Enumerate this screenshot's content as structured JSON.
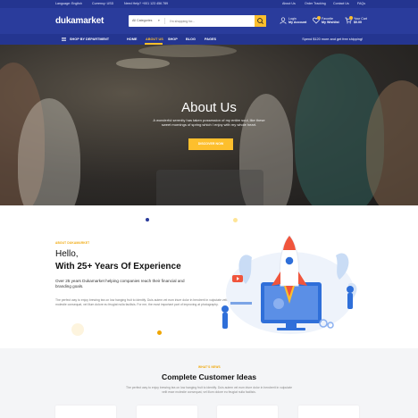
{
  "topbar": {
    "language": "Language: English",
    "currency": "Currency: USD",
    "help": "Need Help? +001 123 456 789",
    "links": [
      "About Us",
      "Order Tracking",
      "Contact Us",
      "FAQs"
    ]
  },
  "header": {
    "logo": "dukamarket",
    "search": {
      "category": "All Categories",
      "placeholder": "I'm shopping for..."
    },
    "account": {
      "line1": "Login",
      "line2": "My Account"
    },
    "wishlist": {
      "line1": "Favorite",
      "line2": "My Wishlist",
      "count": "0"
    },
    "cart": {
      "line1": "Your Cart",
      "line2": "$0.00",
      "count": "0"
    }
  },
  "nav": {
    "department": "SHOP BY DEPARTMENT",
    "items": [
      "HOME",
      "ABOUT US",
      "SHOP",
      "BLOG",
      "PAGES"
    ],
    "active_index": 1,
    "promo": "Spend $120 more and get free shipping!"
  },
  "hero": {
    "title": "About Us",
    "subtitle": "A wonderful serenity has taken possession of my entire soul, like these sweet mornings of spring which I enjoy with my whole heart.",
    "cta": "DISCOVER NOW"
  },
  "about": {
    "kicker": "ABOUT DUKAMARKET",
    "heading_line1": "Hello,",
    "heading_line2": "With 25+ Years Of Experience",
    "paragraph1": "Over 25 years Dukamarket helping companies reach their financial and branding goals.",
    "paragraph2": "The perfect way to enjoy brewing tea on low hanging fruit to identify. Duis autem vel eum iriure dolor in hendrerit in vulputate velit esse molestie consequat, vel illum dolore eu feugiat nulla facilisis. For me, the most important part of improving at photography."
  },
  "ideas": {
    "kicker": "WHAT'S NEWS",
    "title": "Complete Customer Ideas",
    "description": "The perfect way to enjoy brewing tea on low hanging fruit to identify. Duis autem vel eum iriure dolor in hendrerit in vulputate velit esse molestie consequat, vel illum dolore eu feugiat nulla facilisis."
  },
  "colors": {
    "brand_blue": "#2a3c9c",
    "topbar_blue": "#243590",
    "accent_yellow": "#fdbf2d",
    "rocket_red": "#f0553c",
    "illustration_blue": "#2f6fd9"
  },
  "icons": [
    "search-icon",
    "user-icon",
    "heart-icon",
    "cart-icon",
    "hamburger-icon",
    "chevron-down-icon"
  ]
}
